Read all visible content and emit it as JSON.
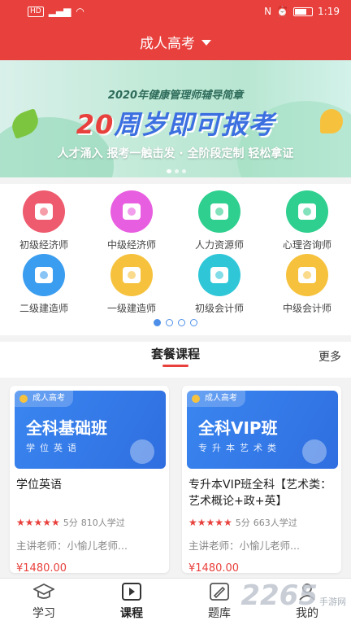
{
  "status_bar": {
    "time": "1:19",
    "left_chips": [
      "HD",
      "4G"
    ]
  },
  "header": {
    "title": "成人高考"
  },
  "banner": {
    "subtitle": "2020年健康管理师辅导简章",
    "headline_num": "20",
    "headline_rest": "周岁即可报考",
    "tagline": "人才涌入 报考一触击发 · 全阶段定制 轻松拿证"
  },
  "categories": [
    {
      "label": "初级经济师",
      "color": "#ee5b6e"
    },
    {
      "label": "中级经济师",
      "color": "#e85ee0"
    },
    {
      "label": "人力资源师",
      "color": "#2fcf8f"
    },
    {
      "label": "心理咨询师",
      "color": "#2fcf8f"
    },
    {
      "label": "二级建造师",
      "color": "#3a9df0"
    },
    {
      "label": "一级建造师",
      "color": "#f6c23e"
    },
    {
      "label": "初级会计师",
      "color": "#2fc7d8"
    },
    {
      "label": "中级会计师",
      "color": "#f6c23e"
    }
  ],
  "packages": {
    "title": "套餐课程",
    "more": "更多",
    "cards": [
      {
        "tag": "成人高考",
        "thumb_name": "全科基础班",
        "thumb_sub": "学位英语",
        "title": "学位英语",
        "score": "5分",
        "learners": "810人学过",
        "teacher": "主讲老师：小愉儿老师...",
        "price": "¥1480.00"
      },
      {
        "tag": "成人高考",
        "thumb_name": "全科VIP班",
        "thumb_sub": "专升本艺术类",
        "title": "专升本VIP班全科【艺术类：艺术概论+政+英】",
        "score": "5分",
        "learners": "663人学过",
        "teacher": "主讲老师：小愉儿老师...",
        "price": "¥1480.00"
      }
    ]
  },
  "bottom_nav": [
    {
      "label": "学习",
      "icon": "graduation-cap-icon"
    },
    {
      "label": "课程",
      "icon": "play-icon"
    },
    {
      "label": "题库",
      "icon": "edit-icon"
    },
    {
      "label": "我的",
      "icon": "user-icon"
    }
  ],
  "watermark": {
    "num": "2265",
    "text": "手游网"
  },
  "colors": {
    "brand": "#e8403c",
    "pager": "#4d8fe8"
  }
}
